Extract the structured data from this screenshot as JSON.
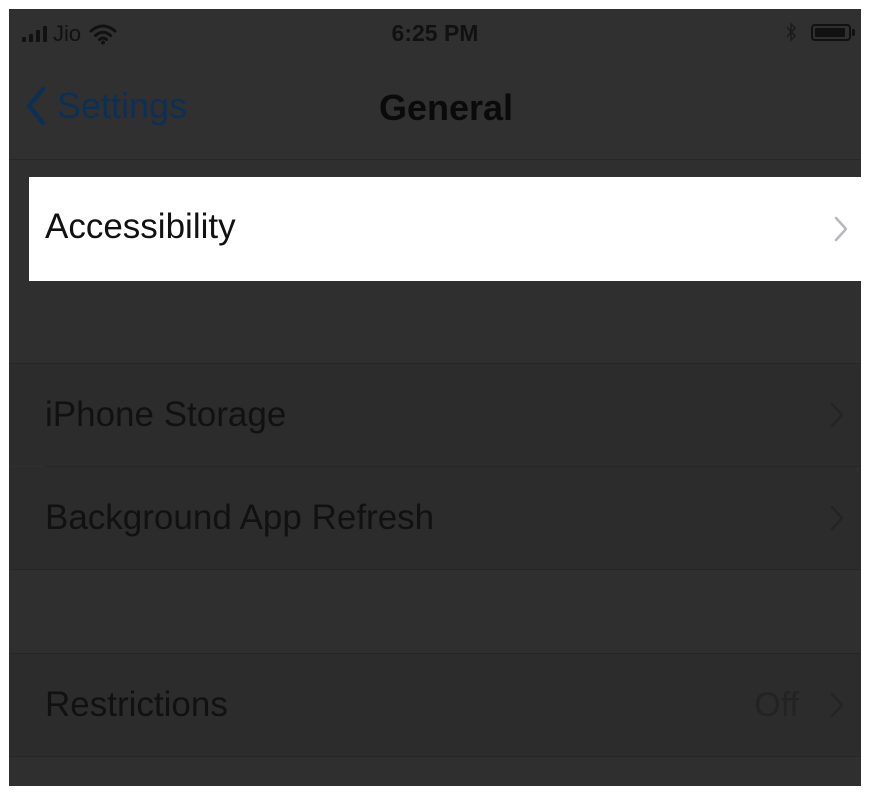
{
  "status_bar": {
    "carrier": "Jio",
    "time": "6:25 PM"
  },
  "nav": {
    "back_label": "Settings",
    "title": "General"
  },
  "rows": {
    "accessibility": {
      "label": "Accessibility"
    },
    "iphone_storage": {
      "label": "iPhone Storage"
    },
    "background_refresh": {
      "label": "Background App Refresh"
    },
    "restrictions": {
      "label": "Restrictions",
      "value": "Off"
    }
  },
  "colors": {
    "overlay_background": "#2f2f2f",
    "highlight_background": "#ffffff",
    "back_link": "#0e2f54"
  }
}
